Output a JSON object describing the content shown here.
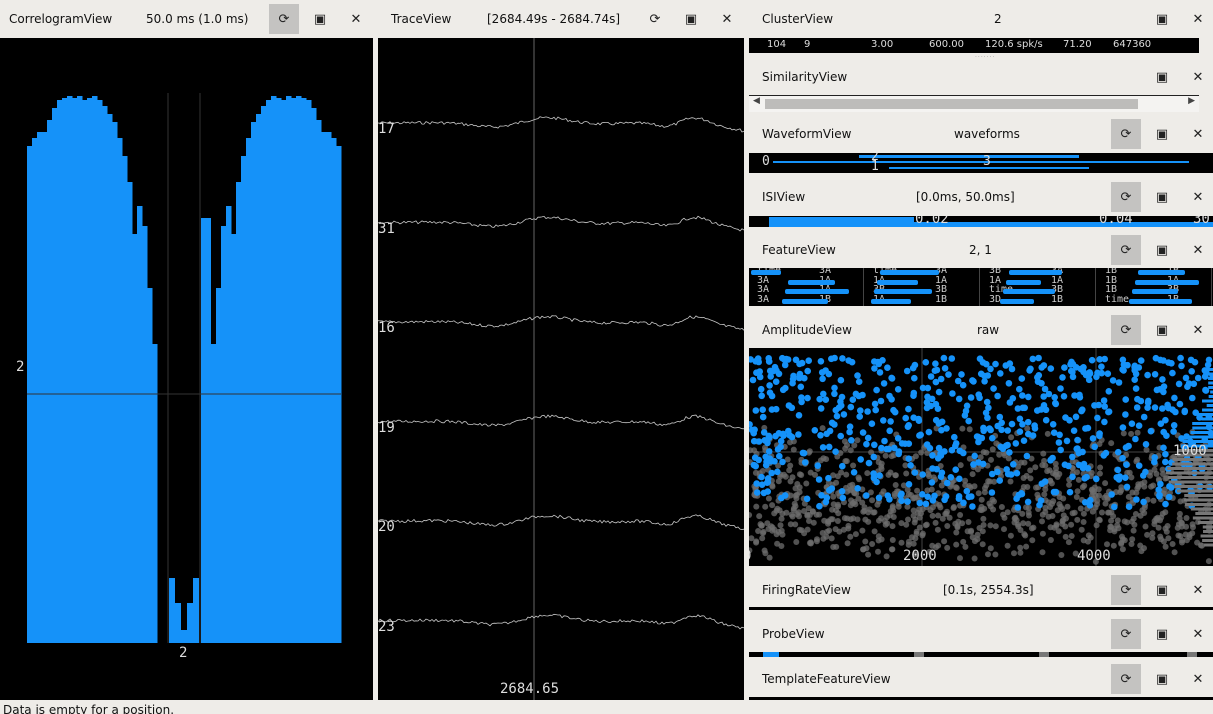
{
  "correlogram": {
    "title": "CorrelogramView",
    "status": "50.0 ms (1.0 ms)",
    "row_label": "2",
    "col_label": "2",
    "color": "#1592f9"
  },
  "trace": {
    "title": "TraceView",
    "status": "[2684.49s - 2684.74s]",
    "channels": [
      "17",
      "31",
      "16",
      "19",
      "20",
      "23"
    ],
    "time_label": "2684.65"
  },
  "cluster": {
    "title": "ClusterView",
    "status": "2",
    "row": [
      "104",
      "9",
      "3.00",
      "600.00",
      "120.6 spk/s",
      "71.20",
      "647360"
    ]
  },
  "similarity": {
    "title": "SimilarityView"
  },
  "waveform": {
    "title": "WaveformView",
    "status": "waveforms",
    "labels": [
      "0",
      "2",
      "1",
      "3"
    ]
  },
  "isi": {
    "title": "ISIView",
    "status": "[0.0ms, 50.0ms]",
    "ticks": [
      "0.02",
      "0.04",
      "30"
    ]
  },
  "feature": {
    "title": "FeatureView",
    "status": "2, 1",
    "cells": [
      "time",
      "3A",
      "time",
      "3A",
      "3B",
      "3A",
      "1B",
      "1B",
      "3A",
      "1A",
      "1A",
      "1A",
      "1A",
      "1A",
      "1B",
      "1A",
      "3A",
      "1A",
      "3B",
      "3B",
      "time",
      "3B",
      "1B",
      "3B",
      "3A",
      "1B",
      "1A",
      "1B",
      "3D",
      "1B",
      "time",
      "1B"
    ]
  },
  "amplitude": {
    "title": "AmplitudeView",
    "status": "raw",
    "x_ticks": [
      "0",
      "2000",
      "4000"
    ],
    "y_label": "1000"
  },
  "firing_rate": {
    "title": "FiringRateView",
    "status": "[0.1s, 2554.3s]"
  },
  "probe": {
    "title": "ProbeView"
  },
  "template_feature": {
    "title": "TemplateFeatureView"
  },
  "icons": {
    "refresh": "⟳",
    "save": "💾",
    "close": "✕"
  },
  "statusbar": {
    "text": "Data is empty for a  position."
  }
}
